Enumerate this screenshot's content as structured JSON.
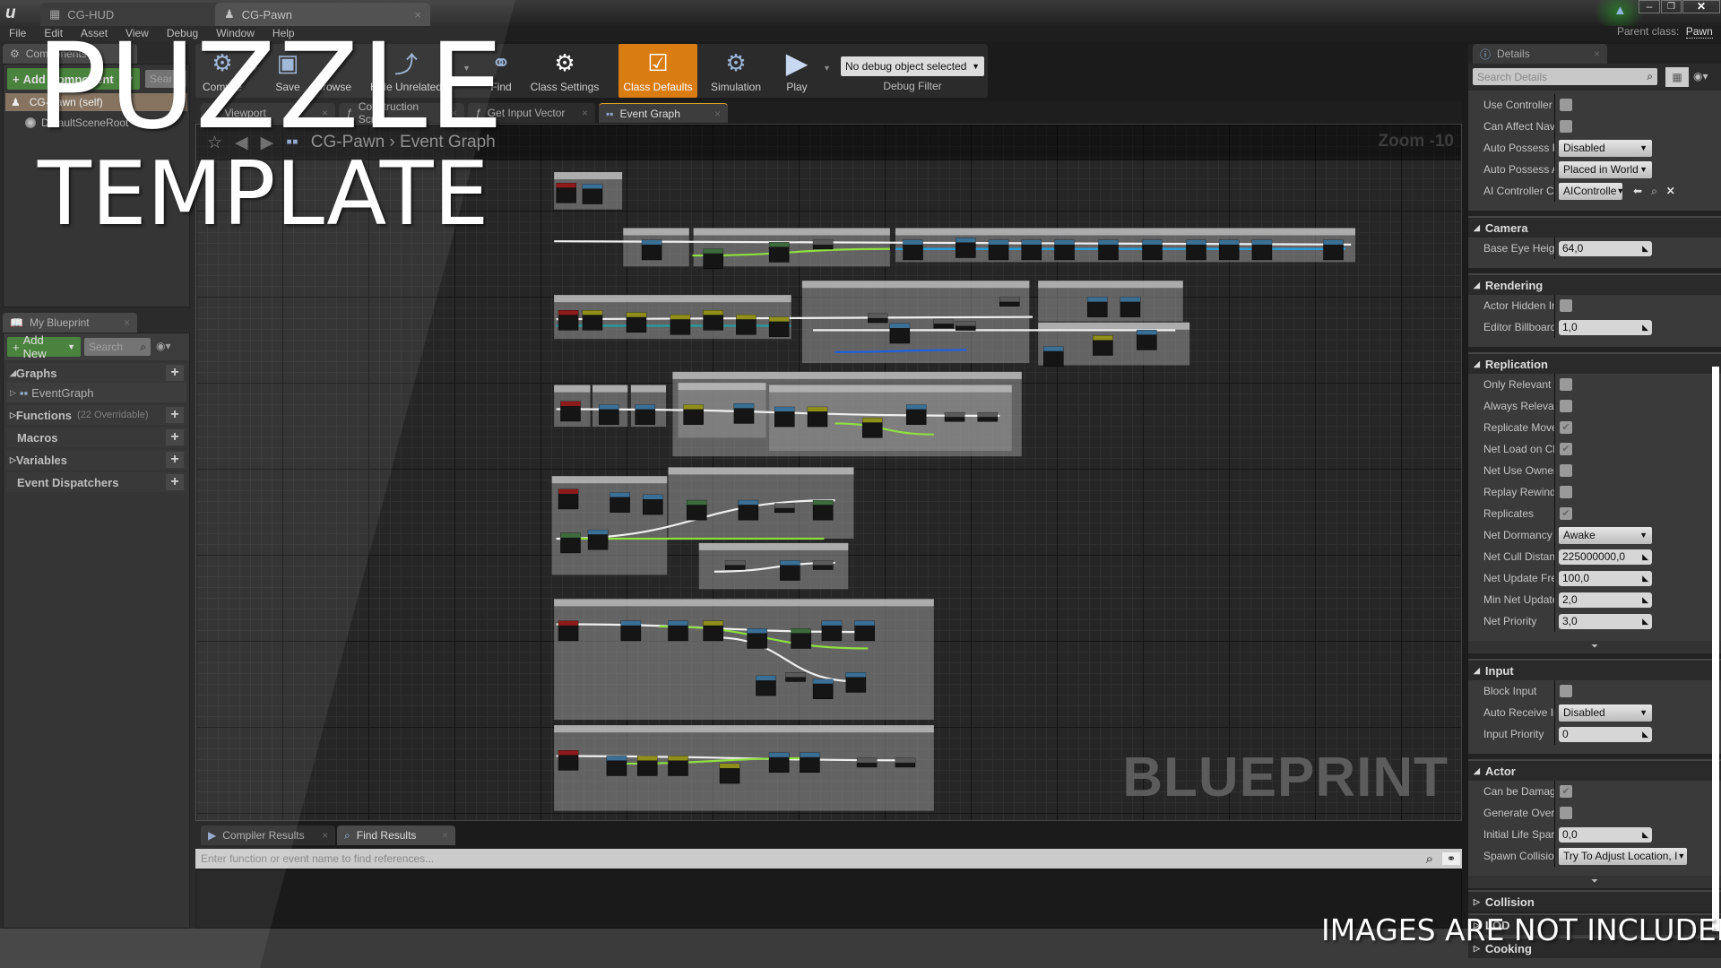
{
  "window": {
    "tabs": [
      {
        "label": "CG-HUD",
        "active": false
      },
      {
        "label": "CG-Pawn",
        "active": true
      }
    ],
    "parent_class_label": "Parent class:",
    "parent_class_value": "Pawn"
  },
  "menu": [
    "File",
    "Edit",
    "Asset",
    "View",
    "Debug",
    "Window",
    "Help"
  ],
  "components": {
    "tab": "Components",
    "add_button": "Add Component",
    "search_placeholder": "Search",
    "tree": [
      "CG-Pawn (self)",
      "DefaultSceneRoot"
    ]
  },
  "toolbar": {
    "buttons": [
      "Compile",
      "Save",
      "Browse",
      "Hide Unrelated",
      "Find",
      "Class Settings",
      "Class Defaults",
      "Simulation",
      "Play"
    ],
    "active": "Class Defaults",
    "debug_object": "No debug object selected",
    "debug_filter_label": "Debug Filter"
  },
  "graph_tabs": [
    "Viewport",
    "Construction Scrip",
    "Get Input Vector",
    "Event Graph"
  ],
  "graph": {
    "breadcrumb": [
      "CG-Pawn",
      "Event Graph"
    ],
    "zoom": "Zoom -10",
    "watermark": "BLUEPRINT"
  },
  "my_blueprint": {
    "tab": "My Blueprint",
    "add_button": "Add New",
    "search_placeholder": "Search",
    "sections": [
      {
        "label": "Graphs",
        "expanded": true,
        "items": [
          "EventGraph"
        ]
      },
      {
        "label": "Functions",
        "note": "(22 Overridable)"
      },
      {
        "label": "Macros"
      },
      {
        "label": "Variables"
      },
      {
        "label": "Event Dispatchers"
      }
    ]
  },
  "bottom": {
    "tabs": [
      "Compiler Results",
      "Find Results"
    ],
    "search_placeholder": "Enter function or event name to find references..."
  },
  "details": {
    "tab": "Details",
    "search_placeholder": "Search Details",
    "sections": [
      {
        "title": "",
        "rows": [
          {
            "label": "Use Controller I",
            "type": "checkbox",
            "checked": false
          },
          {
            "label": "Can Affect Nav",
            "type": "checkbox",
            "checked": false
          },
          {
            "label": "Auto Possess P",
            "type": "dropdown",
            "value": "Disabled"
          },
          {
            "label": "Auto Possess A",
            "type": "dropdown",
            "value": "Placed in World"
          },
          {
            "label": "AI Controller Cl",
            "type": "class",
            "value": "AIControlle"
          }
        ]
      },
      {
        "title": "Camera",
        "rows": [
          {
            "label": "Base Eye Heigh",
            "type": "number",
            "value": "64,0"
          }
        ]
      },
      {
        "title": "Rendering",
        "rows": [
          {
            "label": "Actor Hidden In",
            "type": "checkbox",
            "checked": false
          },
          {
            "label": "Editor Billboard",
            "type": "number",
            "value": "1,0"
          }
        ]
      },
      {
        "title": "Replication",
        "expander": true,
        "rows": [
          {
            "label": "Only Relevant t",
            "type": "checkbox",
            "checked": false
          },
          {
            "label": "Always Relevar",
            "type": "checkbox",
            "checked": false
          },
          {
            "label": "Replicate Move",
            "type": "checkbox",
            "checked": true
          },
          {
            "label": "Net Load on Cli",
            "type": "checkbox",
            "checked": true
          },
          {
            "label": "Net Use Owner",
            "type": "checkbox",
            "checked": false
          },
          {
            "label": "Replay Rewinda",
            "type": "checkbox",
            "checked": false
          },
          {
            "label": "Replicates",
            "type": "checkbox",
            "checked": true
          },
          {
            "label": "Net Dormancy",
            "type": "dropdown",
            "value": "Awake"
          },
          {
            "label": "Net Cull Distan",
            "type": "number",
            "value": "225000000,0"
          },
          {
            "label": "Net Update Fre",
            "type": "number",
            "value": "100,0"
          },
          {
            "label": "Min Net Update",
            "type": "number",
            "value": "2,0"
          },
          {
            "label": "Net Priority",
            "type": "number",
            "value": "3,0"
          }
        ]
      },
      {
        "title": "Input",
        "rows": [
          {
            "label": "Block Input",
            "type": "checkbox",
            "checked": false
          },
          {
            "label": "Auto Receive Ir",
            "type": "dropdown",
            "value": "Disabled"
          },
          {
            "label": "Input Priority",
            "type": "number",
            "value": "0"
          }
        ]
      },
      {
        "title": "Actor",
        "expander": true,
        "rows": [
          {
            "label": "Can be Damage",
            "type": "checkbox",
            "checked": true
          },
          {
            "label": "Generate Overl",
            "type": "checkbox",
            "checked": false
          },
          {
            "label": "Initial Life Spar",
            "type": "number",
            "value": "0,0"
          },
          {
            "label": "Spawn Collisior",
            "type": "dropdown-wide",
            "value": "Try To Adjust Location, I"
          }
        ]
      },
      {
        "title": "Collision",
        "collapsed": true,
        "rows": []
      },
      {
        "title": "LOD",
        "collapsed": true,
        "rows": []
      },
      {
        "title": "Cooking",
        "collapsed": true,
        "rows": []
      }
    ]
  },
  "overlay": {
    "line1": "PUZZLE",
    "line2": "TEMPLATE",
    "footer": "IMAGES ARE NOT INCLUDED"
  },
  "colors": {
    "accent": "#d97c12",
    "green_button": "#3d7a2f",
    "self_row": "#7d6a55"
  }
}
